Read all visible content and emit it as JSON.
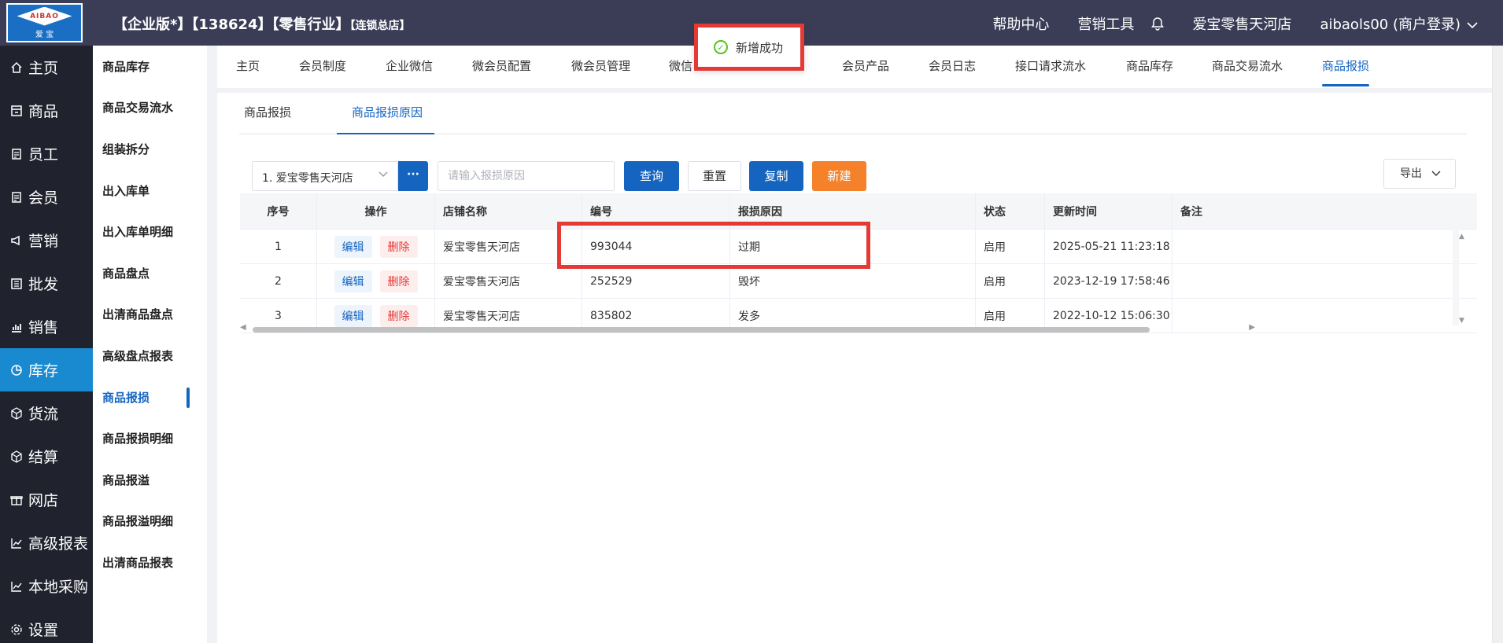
{
  "header": {
    "logo_text": "AIBAO",
    "logo_cn": "爱 宝",
    "title_main": "【企业版*】【138624】【零售行业】",
    "title_small": "【连锁总店】",
    "help": "帮助中心",
    "marketing": "营销工具",
    "store": "爱宝零售天河店",
    "user": "aibaols00 (商户登录)"
  },
  "leftnav": [
    {
      "label": "主页",
      "icon": "home-icon"
    },
    {
      "label": "商品",
      "icon": "goods-icon"
    },
    {
      "label": "员工",
      "icon": "staff-icon"
    },
    {
      "label": "会员",
      "icon": "member-icon"
    },
    {
      "label": "营销",
      "icon": "megaphone-icon"
    },
    {
      "label": "批发",
      "icon": "wholesale-icon"
    },
    {
      "label": "销售",
      "icon": "chart-icon"
    },
    {
      "label": "库存",
      "icon": "pie-icon"
    },
    {
      "label": "货流",
      "icon": "cube-icon"
    },
    {
      "label": "结算",
      "icon": "cube-icon"
    },
    {
      "label": "网店",
      "icon": "gift-icon"
    },
    {
      "label": "高级报表",
      "icon": "trend-icon"
    },
    {
      "label": "本地采购",
      "icon": "trend-icon"
    },
    {
      "label": "设置",
      "icon": "gear-icon"
    }
  ],
  "subnav": [
    "商品库存",
    "商品交易流水",
    "组装拆分",
    "出入库单",
    "出入库单明细",
    "商品盘点",
    "出清商品盘点",
    "高级盘点报表",
    "商品报损",
    "商品报损明细",
    "商品报溢",
    "商品报溢明细",
    "出清商品报表"
  ],
  "tabs": [
    "主页",
    "会员制度",
    "企业微信",
    "微会员配置",
    "微会员管理",
    "微信",
    "会员产品",
    "会员日志",
    "接口请求流水",
    "商品库存",
    "商品交易流水",
    "商品报损"
  ],
  "subtabs": [
    "商品报损",
    "商品报损原因"
  ],
  "toolbar": {
    "store_select": "1. 爱宝零售天河店",
    "dots": "···",
    "reason_placeholder": "请输入报损原因",
    "query": "查询",
    "reset": "重置",
    "copy": "复制",
    "new": "新建",
    "export": "导出"
  },
  "table": {
    "headers": [
      "序号",
      "操作",
      "店铺名称",
      "编号",
      "报损原因",
      "状态",
      "更新时间",
      "备注"
    ],
    "edit_label": "编辑",
    "delete_label": "删除",
    "rows": [
      {
        "idx": "1",
        "store": "爱宝零售天河店",
        "code": "993044",
        "reason": "过期",
        "status": "启用",
        "time": "2025-05-21 11:23:18",
        "note": ""
      },
      {
        "idx": "2",
        "store": "爱宝零售天河店",
        "code": "252529",
        "reason": "毁坏",
        "status": "启用",
        "time": "2023-12-19 17:58:46",
        "note": ""
      },
      {
        "idx": "3",
        "store": "爱宝零售天河店",
        "code": "835802",
        "reason": "发多",
        "status": "启用",
        "time": "2022-10-12 15:06:30",
        "note": ""
      }
    ]
  },
  "toast": {
    "message": "新增成功"
  },
  "colors": {
    "accent": "#1565c0",
    "sidebar": "#20222e",
    "topbar": "#3b3d57",
    "active_nav": "#1a8ad0",
    "orange": "#f5822a",
    "highlight": "#e53935"
  }
}
